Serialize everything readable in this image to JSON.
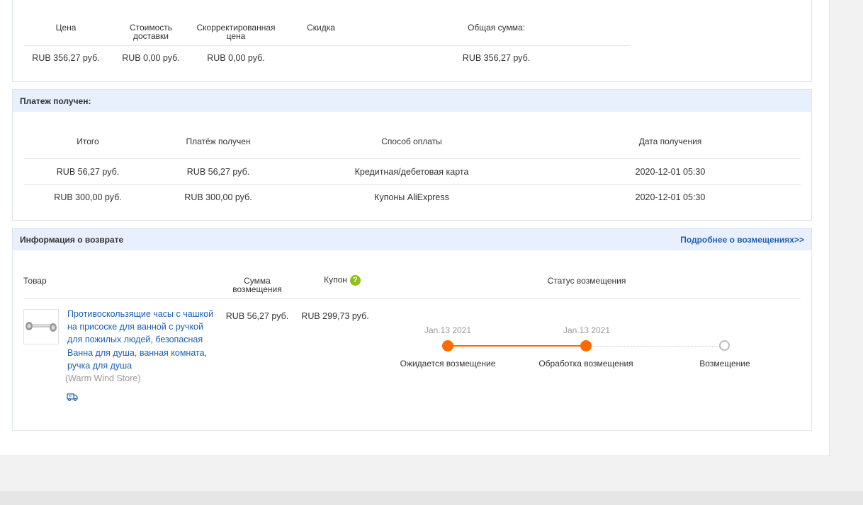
{
  "order_summary": {
    "headers": {
      "price": "Цена",
      "shipping": "Стоимость доставки",
      "adjusted": "Скорректированная цена",
      "discount": "Скидка",
      "total": "Общая сумма:"
    },
    "row": {
      "price": "RUB 356,27 руб.",
      "shipping": "RUB 0,00 руб.",
      "adjusted": "RUB 0,00 руб.",
      "discount": "",
      "total": "RUB 356,27 руб."
    }
  },
  "payment": {
    "title": "Платеж получен:",
    "headers": {
      "total": "Итого",
      "received": "Платёж получен",
      "method": "Способ оплаты",
      "date": "Дата получения"
    },
    "rows": [
      {
        "total": "RUB 56,27 руб.",
        "received": "RUB 56,27 руб.",
        "method": "Кредитная/дебетовая карта",
        "date": "2020-12-01 05:30"
      },
      {
        "total": "RUB 300,00 руб.",
        "received": "RUB 300,00 руб.",
        "method": "Купоны AliExpress",
        "date": "2020-12-01 05:30"
      }
    ]
  },
  "refund": {
    "title": "Информация о возврате",
    "more_link": "Подробнее о возмещениях>>",
    "headers": {
      "product": "Товар",
      "amount": "Сумма возмещения",
      "coupon": "Купон",
      "status": "Статус возмещения"
    },
    "coupon_help_icon": "question-icon",
    "item": {
      "name": "Противоскользящие часы с чашкой на присоске для ванной с ручкой для пожилых людей, безопасная Ванна для душа, ванная комната, ручка для душа",
      "store": "(Warm Wind Store)",
      "amount": "RUB 56,27 руб.",
      "coupon": "RUB 299,73 руб.",
      "shipping_icon": "truck-icon"
    },
    "timeline": {
      "steps": [
        {
          "date": "Jan.13 2021",
          "label": "Ожидается возмещение",
          "done": true
        },
        {
          "date": "Jan.13 2021",
          "label": "Обработка возмещения",
          "done": true
        },
        {
          "date": "",
          "label": "Возмещение",
          "done": false
        }
      ],
      "accent": "#ff6a00",
      "pending": "#bdbdbd"
    }
  },
  "colors": {
    "panel_header": "#e8f0fd",
    "link": "#1c5fb3",
    "coupon_badge": "#8cc21a"
  }
}
